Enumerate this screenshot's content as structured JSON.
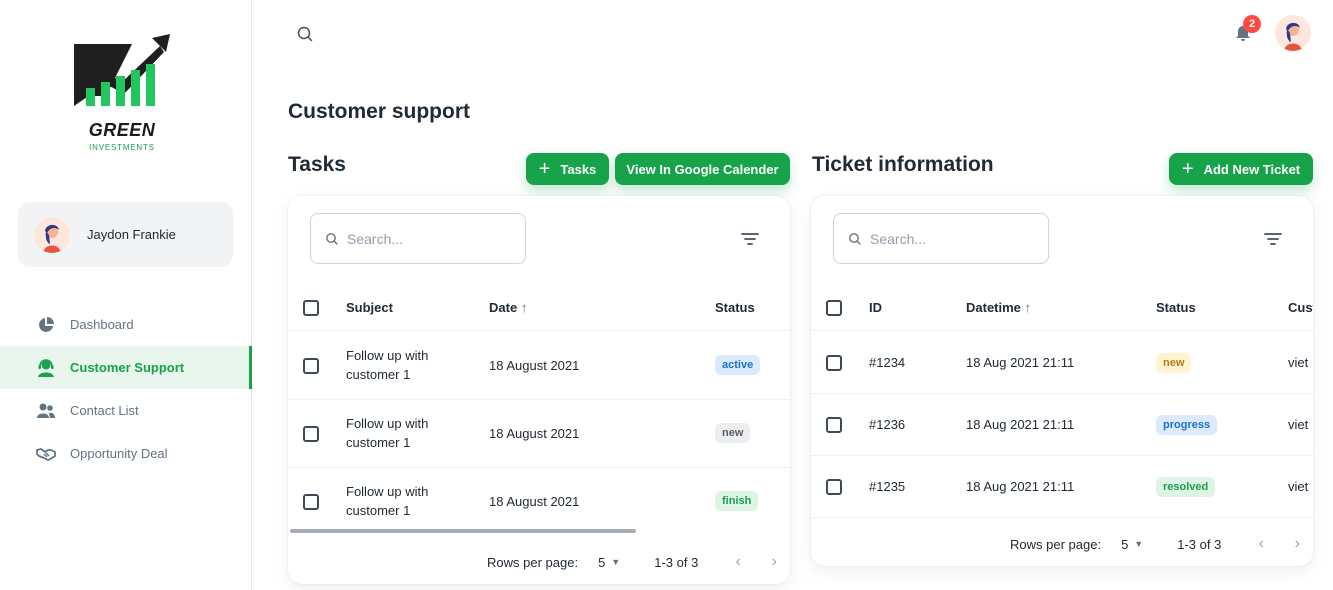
{
  "brand": {
    "name": "GREEN",
    "sub": "INVESTMENTS"
  },
  "user": {
    "name": "Jaydon Frankie"
  },
  "sidebar": {
    "items": [
      {
        "label": "Dashboard",
        "icon": "pie-chart-icon",
        "active": false
      },
      {
        "label": "Customer Support",
        "icon": "support-agent-icon",
        "active": true
      },
      {
        "label": "Contact List",
        "icon": "people-icon",
        "active": false
      },
      {
        "label": "Opportunity Deal",
        "icon": "handshake-icon",
        "active": false
      }
    ]
  },
  "header": {
    "notifications": "2"
  },
  "page": {
    "title": "Customer support"
  },
  "tasks": {
    "title": "Tasks",
    "add_label": "Tasks",
    "calendar_label": "View In Google Calender",
    "search_placeholder": "Search...",
    "columns": [
      "Subject",
      "Date",
      "Status"
    ],
    "rows": [
      {
        "subject_line1": "Follow up with",
        "subject_line2": "customer 1",
        "date": "18 August 2021",
        "status": "active"
      },
      {
        "subject_line1": "Follow up with",
        "subject_line2": "customer 1",
        "date": "18 August 2021",
        "status": "new"
      },
      {
        "subject_line1": "Follow up with",
        "subject_line2": "customer 1",
        "date": "18 August 2021",
        "status": "finish"
      }
    ],
    "pager": {
      "label": "Rows per page:",
      "rows": "5",
      "range": "1-3 of 3"
    }
  },
  "tickets": {
    "title": "Ticket information",
    "add_label": "Add New Ticket",
    "search_placeholder": "Search...",
    "columns": [
      "ID",
      "Datetime",
      "Status",
      "Cust"
    ],
    "rows": [
      {
        "id": "#1234",
        "datetime": "18 Aug 2021 21:11",
        "status": "new",
        "customer": "viet"
      },
      {
        "id": "#1236",
        "datetime": "18 Aug 2021 21:11",
        "status": "progress",
        "customer": "viet"
      },
      {
        "id": "#1235",
        "datetime": "18 Aug 2021 21:11",
        "status": "resolved",
        "customer": "viet"
      }
    ],
    "pager": {
      "label": "Rows per page:",
      "rows": "5",
      "range": "1-3 of 3"
    }
  },
  "colors": {
    "accent": "#16a34a",
    "badge_red": "#ff4842"
  }
}
